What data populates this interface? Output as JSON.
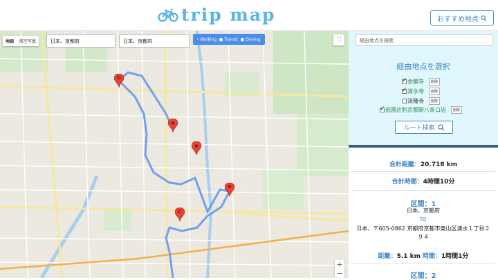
{
  "header": {
    "logo_text": "trip map",
    "recommend_label": "おすすめ地点"
  },
  "map": {
    "map_type": [
      "地図",
      "航空写真"
    ],
    "origin_value": "日本、京都府",
    "destination_value": "日本、京都府",
    "modes": [
      "Walking",
      "Transit",
      "Driving"
    ],
    "markers": [
      "D",
      "B",
      "C"
    ],
    "zoom_in": "+",
    "zoom_out": "−"
  },
  "panel": {
    "waypoint_search_placeholder": "経由地点を検索",
    "select_title": "経由地点を選択",
    "waypoints": [
      {
        "name": "金閣寺",
        "checked": true,
        "delete_label": "削除"
      },
      {
        "name": "清水寺",
        "checked": true,
        "delete_label": "削除"
      },
      {
        "name": "法隆寺",
        "checked": false,
        "delete_label": "削除"
      },
      {
        "name": "祇園辻利京都駅八条口店",
        "checked": true,
        "delete_label": "削除"
      }
    ],
    "route_search_label": "ルート検索"
  },
  "results": {
    "total_distance_label": "合計距離：",
    "total_distance": "20.718 km",
    "total_time_label": "合計時間：",
    "total_time": "4時間10分",
    "section_label": "区間：1",
    "from": "日本、京都府",
    "to_word": "to",
    "to_address": "日本、〒605-0862 京都府京都市東山区清水１丁目２９４",
    "distance_label": "距離：",
    "distance": "5.1 km",
    "time_label": "時間：",
    "time": "1時間1分",
    "section2_label": "区間：2"
  },
  "colors": {
    "accent": "#3f86c4",
    "route": "#6a9cf0",
    "panel_bg": "#dff7fd",
    "divider": "#3d5a80"
  }
}
